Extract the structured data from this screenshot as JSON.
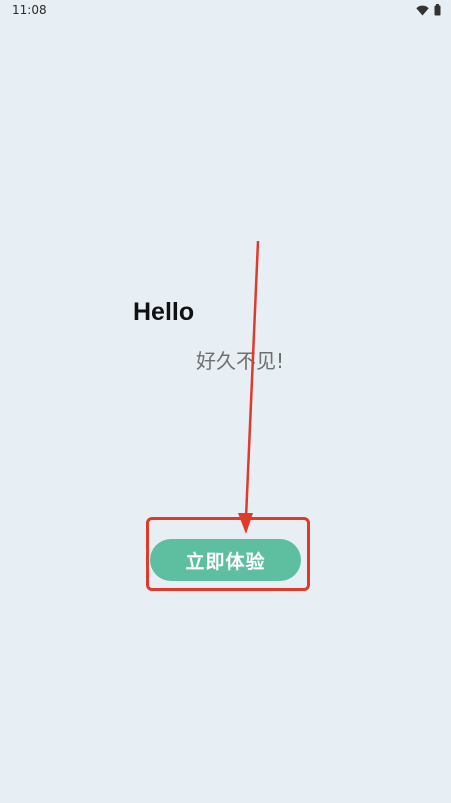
{
  "status_bar": {
    "time": "11:08",
    "icons": [
      "wifi-icon",
      "battery-icon"
    ]
  },
  "main": {
    "title": "Hello",
    "subtitle": "好久不见!",
    "cta_label": "立即体验"
  },
  "colors": {
    "background": "#e7eff4",
    "button": "#5dbf9f",
    "annotation": "#e03a2a"
  }
}
